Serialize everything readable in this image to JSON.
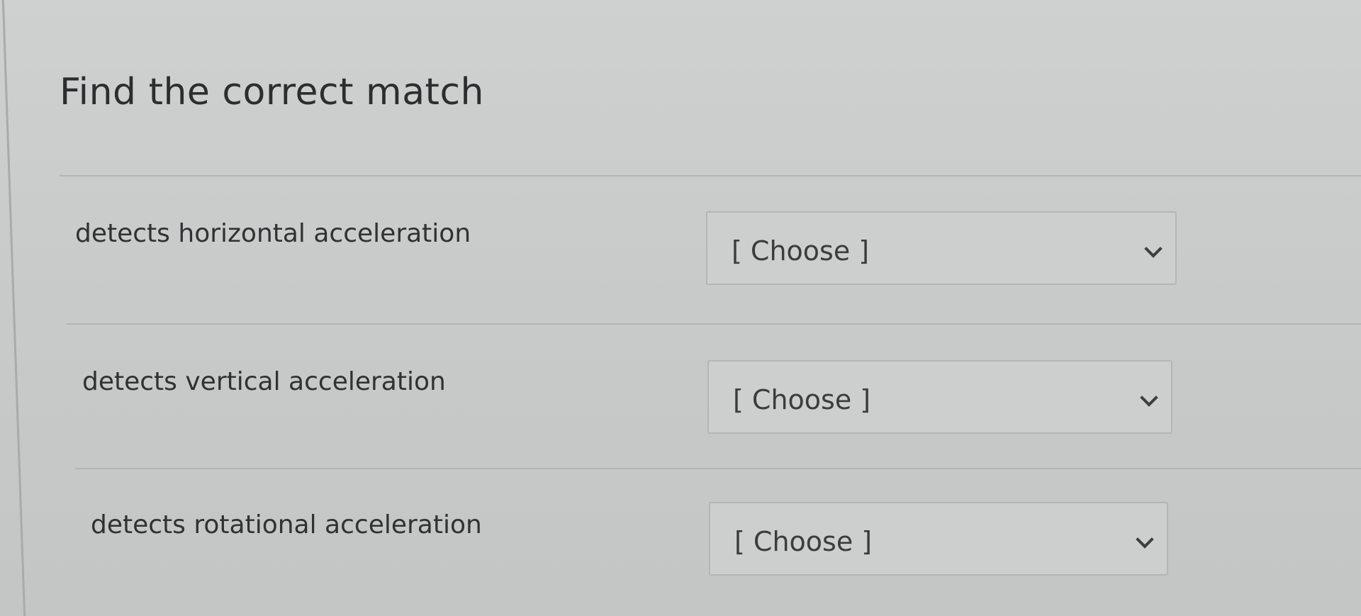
{
  "question": {
    "title": "Find the correct match"
  },
  "matches": [
    {
      "prompt": "detects horizontal acceleration",
      "selected": "[ Choose ]"
    },
    {
      "prompt": "detects vertical acceleration",
      "selected": "[ Choose ]"
    },
    {
      "prompt": "detects rotational acceleration",
      "selected": "[ Choose ]"
    }
  ],
  "icons": {
    "dropdown": "chevron-down-icon"
  }
}
